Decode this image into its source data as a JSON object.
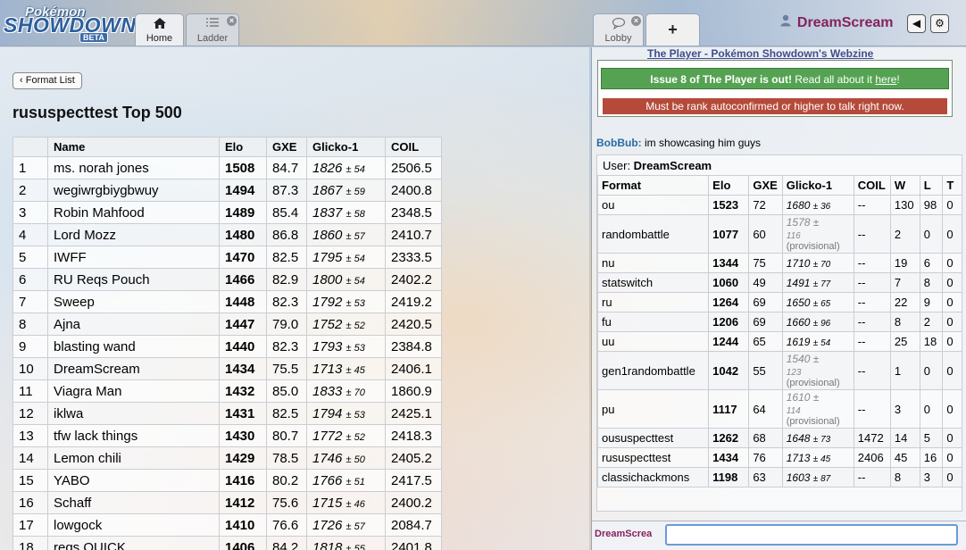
{
  "header": {
    "logo": {
      "top": "Pokémon",
      "main": "SHOWDOWN",
      "badge": "BETA"
    },
    "tabs": {
      "home": {
        "label": "Home",
        "icon": "home-icon"
      },
      "ladder": {
        "label": "Ladder",
        "icon": "list-icon"
      },
      "lobby": {
        "label": "Lobby",
        "icon": "chat-bubble-icon"
      },
      "new_tab": {
        "label": "+"
      }
    },
    "user": {
      "name": "DreamScream",
      "icon": "user-icon"
    },
    "sound_icon": "◀",
    "options_icon": "⚙"
  },
  "ladder": {
    "back_label": "Format List",
    "title": "rususpecttest Top 500",
    "columns": [
      "",
      "Name",
      "Elo",
      "GXE",
      "Glicko-1",
      "COIL"
    ],
    "rows": [
      {
        "rank": "1",
        "name": "ms. norah jones",
        "elo": "1508",
        "gxe": "84.7",
        "glicko": "1826",
        "dev": "± 54",
        "coil": "2506.5"
      },
      {
        "rank": "2",
        "name": "wegiwrgbiygbwuy",
        "elo": "1494",
        "gxe": "87.3",
        "glicko": "1867",
        "dev": "± 59",
        "coil": "2400.8"
      },
      {
        "rank": "3",
        "name": "Robin Mahfood",
        "elo": "1489",
        "gxe": "85.4",
        "glicko": "1837",
        "dev": "± 58",
        "coil": "2348.5"
      },
      {
        "rank": "4",
        "name": "Lord Mozz",
        "elo": "1480",
        "gxe": "86.8",
        "glicko": "1860",
        "dev": "± 57",
        "coil": "2410.7"
      },
      {
        "rank": "5",
        "name": "IWFF",
        "elo": "1470",
        "gxe": "82.5",
        "glicko": "1795",
        "dev": "± 54",
        "coil": "2333.5"
      },
      {
        "rank": "6",
        "name": "RU Reqs Pouch",
        "elo": "1466",
        "gxe": "82.9",
        "glicko": "1800",
        "dev": "± 54",
        "coil": "2402.2"
      },
      {
        "rank": "7",
        "name": "Sweep",
        "elo": "1448",
        "gxe": "82.3",
        "glicko": "1792",
        "dev": "± 53",
        "coil": "2419.2"
      },
      {
        "rank": "8",
        "name": "Ajna",
        "elo": "1447",
        "gxe": "79.0",
        "glicko": "1752",
        "dev": "± 52",
        "coil": "2420.5"
      },
      {
        "rank": "9",
        "name": "blasting wand",
        "elo": "1440",
        "gxe": "82.3",
        "glicko": "1793",
        "dev": "± 53",
        "coil": "2384.8"
      },
      {
        "rank": "10",
        "name": "DreamScream",
        "elo": "1434",
        "gxe": "75.5",
        "glicko": "1713",
        "dev": "± 45",
        "coil": "2406.1"
      },
      {
        "rank": "11",
        "name": "Viagra Man",
        "elo": "1432",
        "gxe": "85.0",
        "glicko": "1833",
        "dev": "± 70",
        "coil": "1860.9"
      },
      {
        "rank": "12",
        "name": "iklwa",
        "elo": "1431",
        "gxe": "82.5",
        "glicko": "1794",
        "dev": "± 53",
        "coil": "2425.1"
      },
      {
        "rank": "13",
        "name": "tfw lack things",
        "elo": "1430",
        "gxe": "80.7",
        "glicko": "1772",
        "dev": "± 52",
        "coil": "2418.3"
      },
      {
        "rank": "14",
        "name": "Lemon chili",
        "elo": "1429",
        "gxe": "78.5",
        "glicko": "1746",
        "dev": "± 50",
        "coil": "2405.2"
      },
      {
        "rank": "15",
        "name": "YABO",
        "elo": "1416",
        "gxe": "80.2",
        "glicko": "1766",
        "dev": "± 51",
        "coil": "2417.5"
      },
      {
        "rank": "16",
        "name": "Schaff",
        "elo": "1412",
        "gxe": "75.6",
        "glicko": "1715",
        "dev": "± 46",
        "coil": "2400.2"
      },
      {
        "rank": "17",
        "name": "lowgock",
        "elo": "1410",
        "gxe": "76.6",
        "glicko": "1726",
        "dev": "± 57",
        "coil": "2084.7"
      },
      {
        "rank": "18",
        "name": "reqs QUICK",
        "elo": "1406",
        "gxe": "84.2",
        "glicko": "1818",
        "dev": "± 55",
        "coil": "2401.8"
      }
    ]
  },
  "chat": {
    "top_link": "The Player - Pokémon Showdown's Webzine",
    "green_bold": "Issue 8 of The Player is out!",
    "green_text": " Read all about it ",
    "green_link": "here",
    "green_end": "!",
    "red_text": "Must be rank autoconfirmed or higher to talk right now.",
    "message": {
      "user": "BobBub:",
      "text": " im showcasing him guys"
    },
    "user_label": "User: ",
    "user_name": "DreamScream",
    "format_columns": [
      "Format",
      "Elo",
      "GXE",
      "Glicko-1",
      "COIL",
      "W",
      "L",
      "T"
    ],
    "formats": [
      {
        "format": "ou",
        "elo": "1523",
        "gxe": "72",
        "glicko": "1680",
        "dev": "± 36",
        "prov": "",
        "coil": "--",
        "w": "130",
        "l": "98",
        "t": "0"
      },
      {
        "format": "randombattle",
        "elo": "1077",
        "gxe": "60",
        "glicko": "1578 ±",
        "dev": "116",
        "prov": "(provisional)",
        "coil": "--",
        "w": "2",
        "l": "0",
        "t": "0"
      },
      {
        "format": "nu",
        "elo": "1344",
        "gxe": "75",
        "glicko": "1710",
        "dev": "± 70",
        "prov": "",
        "coil": "--",
        "w": "19",
        "l": "6",
        "t": "0"
      },
      {
        "format": "statswitch",
        "elo": "1060",
        "gxe": "49",
        "glicko": "1491",
        "dev": "± 77",
        "prov": "",
        "coil": "--",
        "w": "7",
        "l": "8",
        "t": "0"
      },
      {
        "format": "ru",
        "elo": "1264",
        "gxe": "69",
        "glicko": "1650",
        "dev": "± 65",
        "prov": "",
        "coil": "--",
        "w": "22",
        "l": "9",
        "t": "0"
      },
      {
        "format": "fu",
        "elo": "1206",
        "gxe": "69",
        "glicko": "1660",
        "dev": "± 96",
        "prov": "",
        "coil": "--",
        "w": "8",
        "l": "2",
        "t": "0"
      },
      {
        "format": "uu",
        "elo": "1244",
        "gxe": "65",
        "glicko": "1619",
        "dev": "± 54",
        "prov": "",
        "coil": "--",
        "w": "25",
        "l": "18",
        "t": "0"
      },
      {
        "format": "gen1randombattle",
        "elo": "1042",
        "gxe": "55",
        "glicko": "1540 ±",
        "dev": "123",
        "prov": "(provisional)",
        "coil": "--",
        "w": "1",
        "l": "0",
        "t": "0"
      },
      {
        "format": "pu",
        "elo": "1117",
        "gxe": "64",
        "glicko": "1610 ±",
        "dev": "114",
        "prov": "(provisional)",
        "coil": "--",
        "w": "3",
        "l": "0",
        "t": "0"
      },
      {
        "format": "oususpecttest",
        "elo": "1262",
        "gxe": "68",
        "glicko": "1648",
        "dev": "± 73",
        "prov": "",
        "coil": "1472",
        "w": "14",
        "l": "5",
        "t": "0"
      },
      {
        "format": "rususpecttest",
        "elo": "1434",
        "gxe": "76",
        "glicko": "1713",
        "dev": "± 45",
        "prov": "",
        "coil": "2406",
        "w": "45",
        "l": "16",
        "t": "0"
      },
      {
        "format": "classichackmons",
        "elo": "1198",
        "gxe": "63",
        "glicko": "1603",
        "dev": "± 87",
        "prov": "",
        "coil": "--",
        "w": "8",
        "l": "3",
        "t": "0"
      }
    ],
    "input_user": "DreamScrea",
    "input_value": ""
  }
}
